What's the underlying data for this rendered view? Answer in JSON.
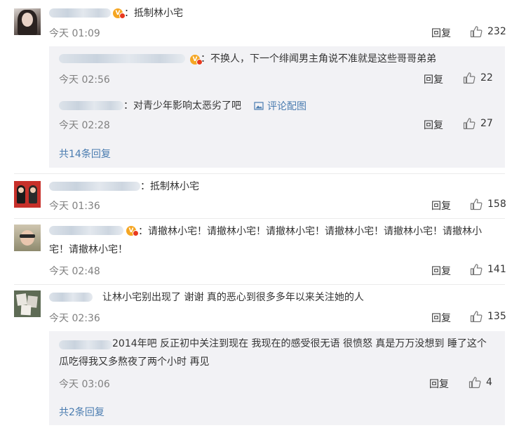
{
  "comments": [
    {
      "text": "：抵制林小宅",
      "time": "今天 01:09",
      "reply_label": "回复",
      "likes": "232",
      "sub_replies": [
        {
          "text": "：不换人，下一个绯闻男主角说不准就是这些哥哥弟弟",
          "time": "今天 02:56",
          "reply_label": "回复",
          "likes": "22"
        },
        {
          "text": "：对青少年影响太恶劣了吧",
          "link_label": "评论配图",
          "time": "今天 02:28",
          "reply_label": "回复",
          "likes": "27"
        }
      ],
      "more_label": "共14条回复"
    },
    {
      "text": "：抵制林小宅",
      "time": "今天 01:36",
      "reply_label": "回复",
      "likes": "158"
    },
    {
      "text": "：请撤林小宅！请撤林小宅！请撤林小宅！请撤林小宅！请撤林小宅！请撤林小宅！请撤林小宅！",
      "time": "今天 02:48",
      "reply_label": "回复",
      "likes": "141"
    },
    {
      "text": "让林小宅别出现了 谢谢 真的恶心到很多多年以来关注她的人",
      "time": "今天 02:36",
      "reply_label": "回复",
      "likes": "135",
      "sub_replies": [
        {
          "text": "2014年吧 反正初中关注到现在 我现在的感受很无语 很愤怒 真是万万没想到 睡了这个瓜吃得我又多熬夜了两个小时 再见",
          "time": "今天 03:06",
          "reply_label": "回复",
          "likes": "4"
        }
      ],
      "more_label": "共2条回复"
    }
  ],
  "icons": {
    "like": "thumbs-up-icon",
    "image": "image-icon",
    "vip": "vip-badge-icon"
  },
  "colors": {
    "link": "#4a7cb0",
    "time": "#808080",
    "sub_background": "#f2f2f5"
  }
}
